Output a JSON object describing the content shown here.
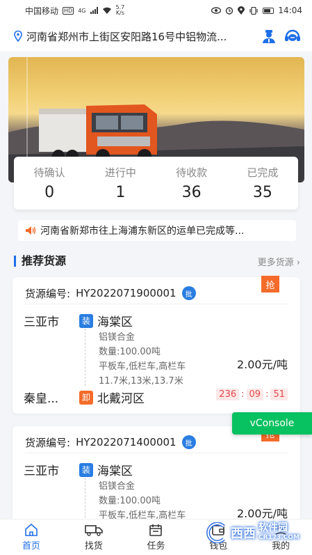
{
  "status_bar": {
    "carrier": "中国移动",
    "hd": "HD",
    "network": "4G",
    "speed_value": "5.7",
    "speed_unit": "K/s",
    "time": "14:04"
  },
  "address": {
    "text": "河南省郑州市上街区安阳路16号中铝物流..."
  },
  "banner": {
    "slide_count": 2,
    "active_slide": 2
  },
  "stats": [
    {
      "label": "待确认",
      "value": "0"
    },
    {
      "label": "进行中",
      "value": "1"
    },
    {
      "label": "待收款",
      "value": "36"
    },
    {
      "label": "已完成",
      "value": "35"
    }
  ],
  "notice": {
    "text": "河南省新郑市往上海浦东新区的运单已完成等..."
  },
  "section": {
    "title": "推荐货源",
    "more": "更多货源"
  },
  "cards": [
    {
      "id_label": "货源编号:",
      "id": "HY2022071900001",
      "badge": "批",
      "grab": "抢",
      "from_city": "三亚市",
      "load_tag": "装",
      "load_area": "海棠区",
      "goods": "铝镁合金",
      "quantity": "数量:100.00吨",
      "vehicles": "平板车,低栏车,高栏车",
      "lengths": "11.7米,13米,13.7米",
      "price": "2.00元/吨",
      "to_city": "秦皇...",
      "unload_tag": "卸",
      "unload_area": "北戴河区",
      "timer_h": "236",
      "timer_m": "09",
      "timer_s": "51"
    },
    {
      "id_label": "货源编号:",
      "id": "HY2022071400001",
      "badge": "批",
      "grab": "抢",
      "from_city": "三亚市",
      "load_tag": "装",
      "load_area": "海棠区",
      "goods": "铝镁合金",
      "quantity": "数量:100.00吨",
      "vehicles": "平板车,低栏车,高栏车",
      "price": "2.00元/吨"
    }
  ],
  "vconsole": "vConsole",
  "nav": [
    {
      "label": "首页",
      "icon": "home-icon",
      "active": true
    },
    {
      "label": "找货",
      "icon": "truck-icon",
      "active": false
    },
    {
      "label": "任务",
      "icon": "calendar-icon",
      "active": false
    },
    {
      "label": "钱包",
      "icon": "wallet-icon",
      "active": false
    },
    {
      "label": "我的",
      "icon": "user-icon",
      "active": false
    }
  ],
  "watermark": {
    "brand": "西西",
    "site": "软件园",
    "domain": "CR173.COM"
  },
  "colors": {
    "primary": "#1e6fe8",
    "accent": "#f46b2a",
    "timer": "#e24a4a",
    "vconsole": "#08c160"
  }
}
